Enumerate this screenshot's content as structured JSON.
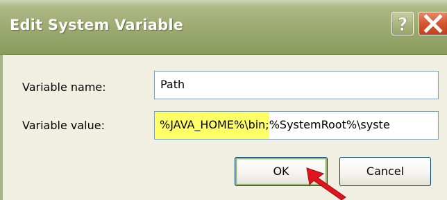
{
  "dialog": {
    "title": "Edit System Variable"
  },
  "titlebar": {
    "help_icon": "question-mark-icon",
    "close_icon": "close-x-icon"
  },
  "form": {
    "name_label": "Variable name:",
    "name_value": "Path",
    "value_label": "Variable value:",
    "value_highlighted": "%JAVA_HOME%\\bin;",
    "value_rest": "%SystemRoot%\\systе"
  },
  "buttons": {
    "ok_label": "OK",
    "cancel_label": "Cancel"
  },
  "annotation": {
    "arrow_icon": "red-pointer-arrow",
    "arrow_color": "#e0141e",
    "highlight_color": "#ffff66"
  }
}
